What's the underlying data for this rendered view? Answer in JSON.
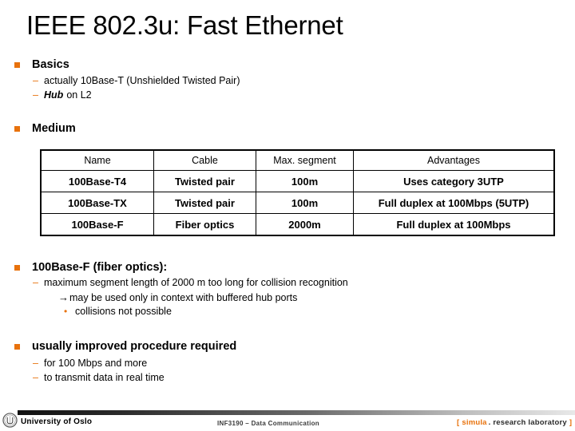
{
  "slide": {
    "title": "IEEE 802.3u: Fast Ethernet",
    "bullets": {
      "basics": {
        "heading": "Basics",
        "sub": [
          "actually 10Base-T (Unshielded Twisted Pair)",
          "on L2"
        ],
        "sub_emphasis": "Hub"
      },
      "medium": {
        "heading": "Medium"
      },
      "fiber": {
        "heading": "100Base-F (fiber optics):",
        "sub": "maximum segment length of 2000 m too long for collision recognition",
        "arrow_line": "may be used only in context with buffered hub ports",
        "arrow_glyph": "→",
        "dot_line": "collisions not possible",
        "dot_glyph": "•"
      },
      "procedure": {
        "heading": "usually improved procedure required",
        "sub": [
          "for 100 Mbps and more",
          "to transmit data in real time"
        ]
      }
    },
    "table": {
      "headers": [
        "Name",
        "Cable",
        "Max. segment",
        "Advantages"
      ],
      "rows": [
        [
          "100Base-T4",
          "Twisted pair",
          "100m",
          "Uses category 3UTP"
        ],
        [
          "100Base-TX",
          "Twisted pair",
          "100m",
          "Full duplex at 100Mbps (5UTP)"
        ],
        [
          "100Base-F",
          "Fiber optics",
          "2000m",
          "Full duplex at 100Mbps"
        ]
      ]
    },
    "footer": {
      "university": "University of Oslo",
      "course": "INF3190 – Data Communication",
      "lab_open": "[",
      "lab_brand": "simula",
      "lab_rest": ". research laboratory",
      "lab_close": "]"
    },
    "colors": {
      "bullet_orange": "#E8720C",
      "text_black": "#000000"
    },
    "icons": {
      "dash": "–",
      "square_bullet": "square-bullet-icon",
      "uio_seal": "uio-seal-icon"
    }
  }
}
